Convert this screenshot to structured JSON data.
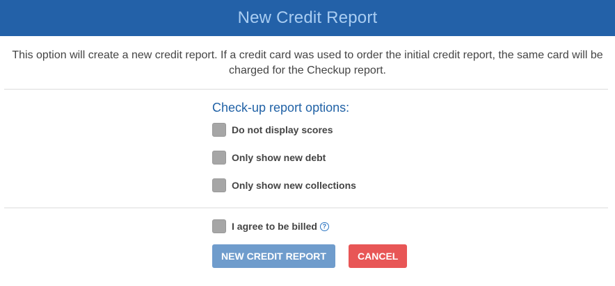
{
  "dialog": {
    "title": "New Credit Report",
    "intro_line1": "This option will create a new credit report. If a credit card was used to order the initial credit report, the same card will be",
    "intro_line2": "charged for the Checkup report."
  },
  "options": {
    "heading": "Check-up report options:",
    "items": [
      {
        "label": "Do not display scores",
        "checked": false
      },
      {
        "label": "Only show new debt",
        "checked": false
      },
      {
        "label": "Only show new collections",
        "checked": false
      }
    ]
  },
  "agree": {
    "label": "I agree to be billed",
    "checked": false,
    "help_glyph": "?"
  },
  "buttons": {
    "submit_label": "NEW CREDIT REPORT",
    "cancel_label": "CANCEL"
  },
  "colors": {
    "header_bg": "#2361a8",
    "title_text": "#a9cdf2",
    "heading_text": "#2162a6",
    "submit_bg": "#6f9ccc",
    "cancel_bg": "#e85656",
    "checkbox_bg": "#a6a6a6"
  },
  "icons": {
    "help": "question-circle-icon"
  }
}
